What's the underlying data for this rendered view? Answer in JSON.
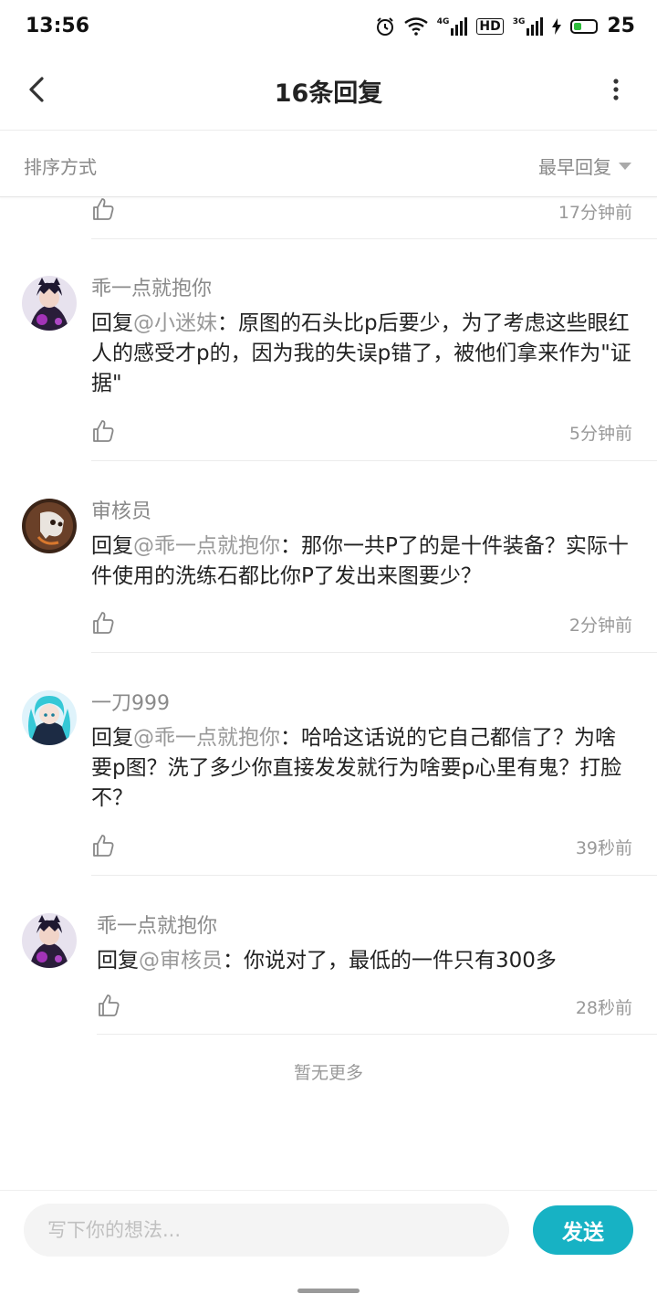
{
  "status_bar": {
    "time": "13:56",
    "network_1": "4G",
    "network_hd": "HD",
    "network_2": "3G",
    "battery_level": "25"
  },
  "header": {
    "title": "16条回复",
    "back_icon": "chevron-left-icon",
    "more_icon": "more-vertical-icon"
  },
  "sort": {
    "label": "排序方式",
    "selected": "最早回复"
  },
  "partial_reply": {
    "time": "17分钟前"
  },
  "replies": [
    {
      "author": "乖一点就抱你",
      "reply_prefix": "回复",
      "mention": "@小迷妹",
      "text": "：原图的石头比p后要少，为了考虑这些眼红人的感受才p的，因为我的失误p错了，被他们拿来作为\"证据\"",
      "time": "5分钟前",
      "avatar_color": "#3a2a4a"
    },
    {
      "author": "审核员",
      "reply_prefix": "回复",
      "mention": "@乖一点就抱你",
      "text": "：那你一共P了的是十件装备？实际十件使用的洗练石都比你P了发出来图要少？",
      "time": "2分钟前",
      "avatar_color": "#5a3a26"
    },
    {
      "author": "一刀999",
      "reply_prefix": "回复",
      "mention": "@乖一点就抱你",
      "text": "：哈哈这话说的它自己都信了？为啥要p图？洗了多少你直接发发就行为啥要p心里有鬼？打脸不？",
      "time": "39秒前",
      "avatar_color": "#3cc7d6"
    },
    {
      "author": "乖一点就抱你",
      "reply_prefix": "回复",
      "mention": "@审核员",
      "text": "：你说对了，最低的一件只有300多",
      "time": "28秒前",
      "avatar_color": "#3a2a4a"
    }
  ],
  "footer_text": "暂无更多",
  "input": {
    "placeholder": "写下你的想法..."
  },
  "send_label": "发送",
  "colors": {
    "accent": "#17b2c4",
    "meta_text": "#999999"
  }
}
